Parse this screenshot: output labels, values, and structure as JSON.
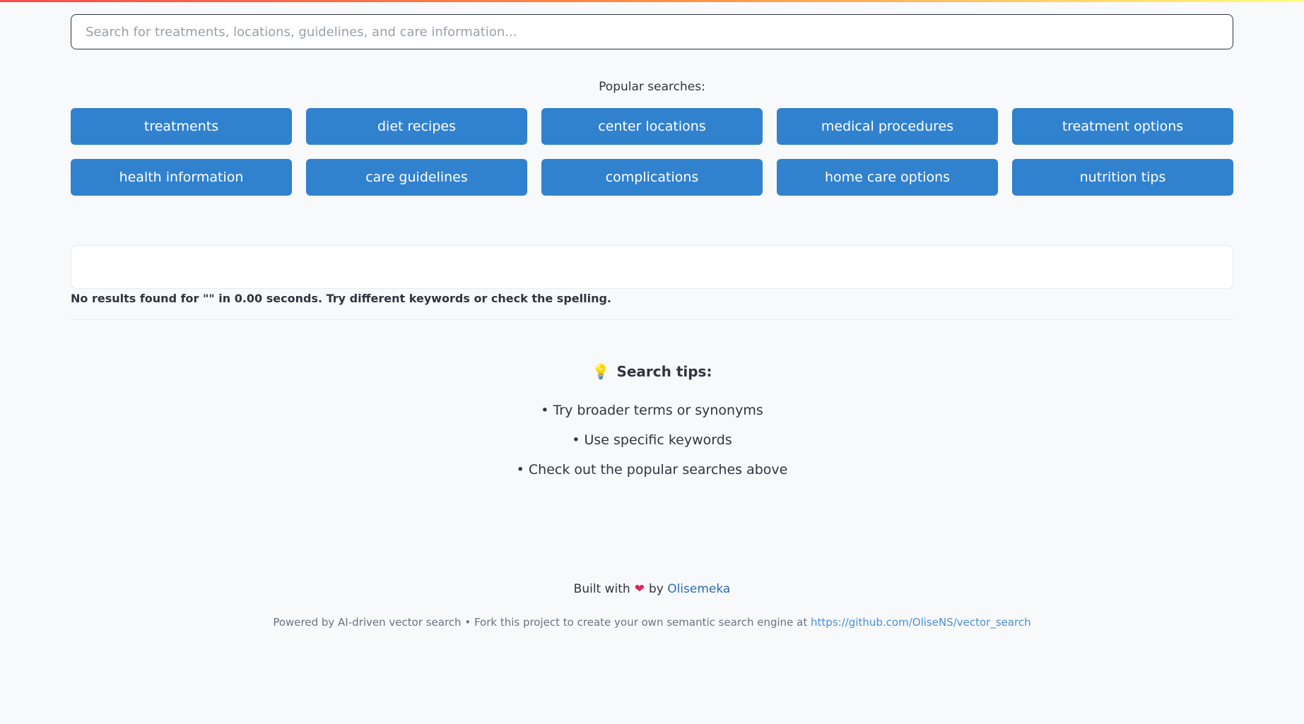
{
  "search": {
    "placeholder": "Search for treatments, locations, guidelines, and care information...",
    "value": ""
  },
  "popular": {
    "label": "Popular searches:",
    "items": [
      "treatments",
      "diet recipes",
      "center locations",
      "medical procedures",
      "treatment options",
      "health information",
      "care guidelines",
      "complications",
      "home care options",
      "nutrition tips"
    ]
  },
  "results": {
    "message": "No results found for \"\" in 0.00 seconds. Try different keywords or check the spelling."
  },
  "tips": {
    "icon": "lightbulb-icon",
    "title": "Search tips:",
    "items": [
      "• Try broader terms or synonyms",
      "• Use specific keywords",
      "• Check out the popular searches above"
    ]
  },
  "footer": {
    "built_with": "Built with",
    "heart_icon": "heart-icon",
    "by": "by",
    "author": "Olisemeka",
    "powered": "Powered by AI-driven vector search • Fork this project to create your own semantic search engine at",
    "repo": "https://github.com/OliseNS/vector_search"
  },
  "colors": {
    "button": "#3182ce",
    "link": "#2b6cb0",
    "background": "#f8f9fb"
  }
}
